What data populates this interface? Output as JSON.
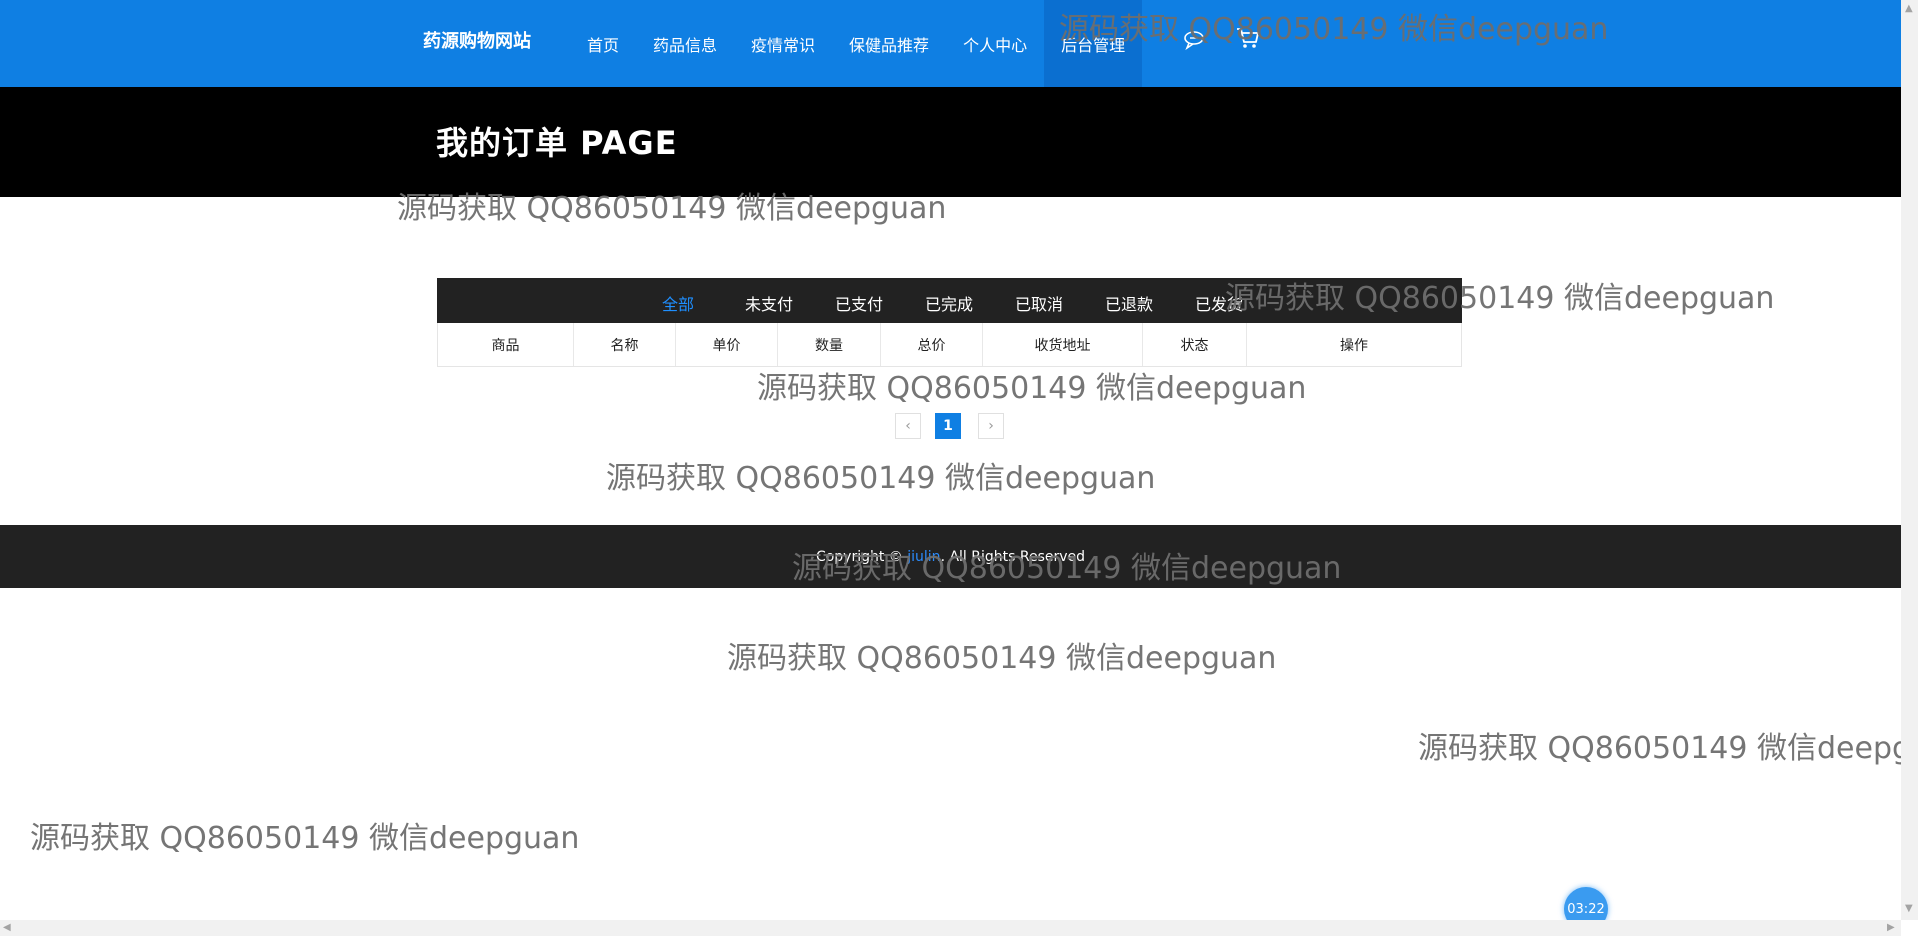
{
  "header": {
    "brand": "药源购物网站",
    "nav": [
      "首页",
      "药品信息",
      "疫情常识",
      "保健品推荐",
      "个人中心",
      "后台管理"
    ],
    "icons": [
      "chat-icon",
      "cart-icon"
    ]
  },
  "banner": {
    "title": "我的订单 PAGE"
  },
  "tabs": [
    "全部",
    "未支付",
    "已支付",
    "已完成",
    "已取消",
    "已退款",
    "已发货"
  ],
  "table": {
    "headers": [
      "商品",
      "名称",
      "单价",
      "数量",
      "总价",
      "收货地址",
      "状态",
      "操作"
    ]
  },
  "pagination": {
    "prev": "‹",
    "current": "1",
    "next": "›"
  },
  "footer": {
    "prefix": "Copyright © ",
    "brand": "jiulin",
    "suffix": ". All Rights Reserved"
  },
  "watermark": "源码获取 QQ86050149 微信deepguan",
  "timer": "03:22",
  "colors": {
    "header": "#0f7fe3",
    "banner": "#000000",
    "tab_active": "#1f8fff",
    "footer": "#222222"
  }
}
